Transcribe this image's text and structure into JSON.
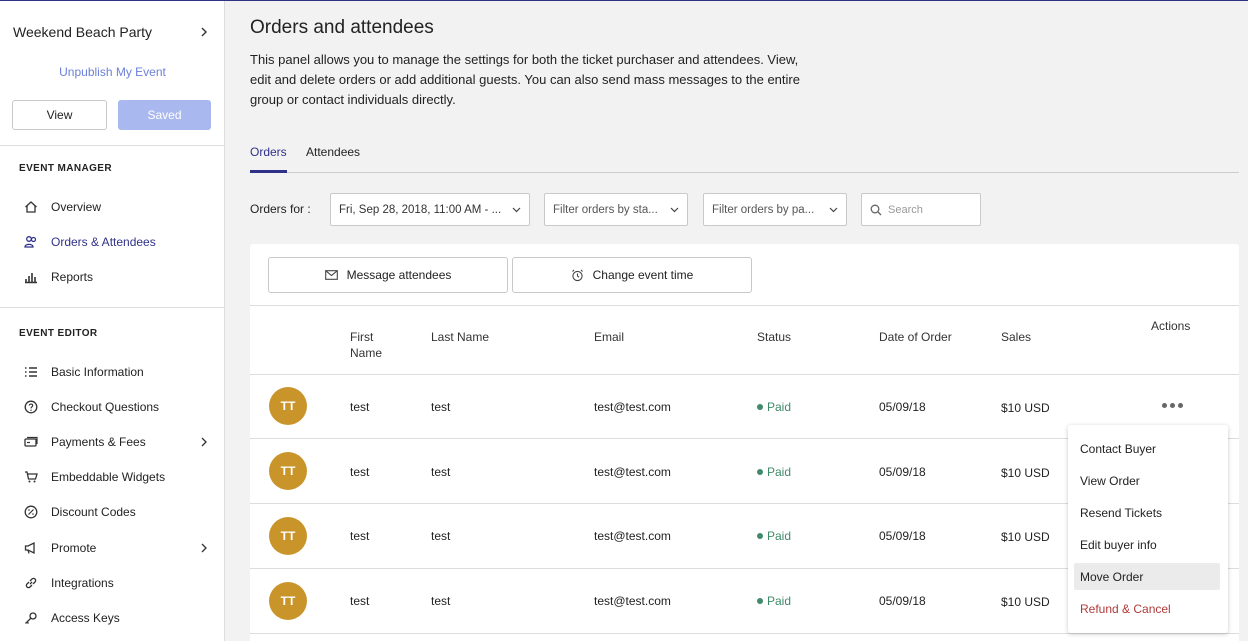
{
  "sidebar": {
    "event_name": "Weekend Beach Party",
    "unpublish_label": "Unpublish My Event",
    "view_label": "View",
    "saved_label": "Saved",
    "manager_heading": "EVENT MANAGER",
    "manager_items": [
      {
        "label": "Overview",
        "icon": "home-icon"
      },
      {
        "label": "Orders & Attendees",
        "icon": "users-icon",
        "active": true
      },
      {
        "label": "Reports",
        "icon": "bar-chart-icon"
      }
    ],
    "editor_heading": "EVENT EDITOR",
    "editor_items": [
      {
        "label": "Basic Information",
        "icon": "list-icon"
      },
      {
        "label": "Checkout Questions",
        "icon": "question-icon"
      },
      {
        "label": "Payments & Fees",
        "icon": "payment-icon",
        "has_submenu": true
      },
      {
        "label": "Embeddable Widgets",
        "icon": "cart-icon"
      },
      {
        "label": "Discount Codes",
        "icon": "discount-icon"
      },
      {
        "label": "Promote",
        "icon": "megaphone-icon",
        "has_submenu": true
      },
      {
        "label": "Integrations",
        "icon": "link-icon"
      },
      {
        "label": "Access Keys",
        "icon": "key-icon"
      }
    ]
  },
  "main": {
    "title": "Orders and attendees",
    "description": "This panel allows you to manage the settings for both the ticket purchaser and attendees. View, edit and delete orders or add additional guests. You can also send mass messages to the entire group or contact individuals directly.",
    "tabs": [
      {
        "label": "Orders",
        "active": true
      },
      {
        "label": "Attendees",
        "active": false
      }
    ],
    "filters": {
      "orders_for_label": "Orders for :",
      "date_select": "Fri, Sep 28, 2018, 11:00 AM - ...",
      "status_select": "Filter orders by sta...",
      "payment_select": "Filter orders by pa...",
      "search_placeholder": "Search"
    },
    "actions": {
      "message_label": "Message attendees",
      "change_time_label": "Change event time"
    },
    "table": {
      "headers": {
        "first_name": "First Name",
        "last_name": "Last Name",
        "email": "Email",
        "status": "Status",
        "date": "Date of Order",
        "sales": "Sales",
        "actions": "Actions"
      },
      "rows": [
        {
          "initials": "TT",
          "first": "test",
          "last": "test",
          "email": "test@test.com",
          "status": "Paid",
          "date": "05/09/18",
          "sales": "$10 USD"
        },
        {
          "initials": "TT",
          "first": "test",
          "last": "test",
          "email": "test@test.com",
          "status": "Paid",
          "date": "05/09/18",
          "sales": "$10 USD"
        },
        {
          "initials": "TT",
          "first": "test",
          "last": "test",
          "email": "test@test.com",
          "status": "Paid",
          "date": "05/09/18",
          "sales": "$10 USD"
        },
        {
          "initials": "TT",
          "first": "test",
          "last": "test",
          "email": "test@test.com",
          "status": "Paid",
          "date": "05/09/18",
          "sales": "$10 USD"
        }
      ]
    },
    "action_menu": {
      "items": [
        {
          "label": "Contact Buyer"
        },
        {
          "label": "View Order"
        },
        {
          "label": "Resend Tickets"
        },
        {
          "label": "Edit buyer info"
        },
        {
          "label": "Move Order",
          "hovered": true
        },
        {
          "label": "Refund & Cancel",
          "danger": true
        }
      ]
    }
  },
  "colors": {
    "accent": "#2f3189",
    "saved_button": "#aab8f0",
    "avatar": "#c9952b",
    "paid": "#3f8a6b",
    "danger": "#b03a3a"
  }
}
